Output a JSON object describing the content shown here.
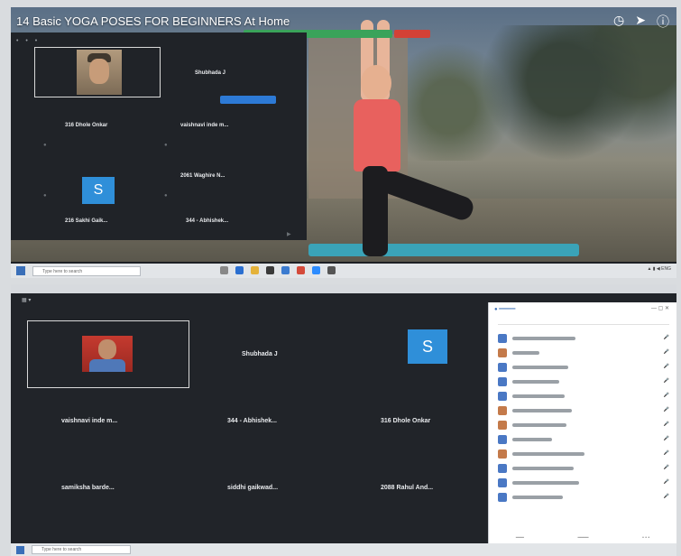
{
  "top": {
    "video_title": "14 Basic YOGA POSES FOR BEGINNERS At Home",
    "participants": [
      {
        "name": "Shubhada J"
      },
      {
        "name": "316 Dhole Onkar"
      },
      {
        "name": "vaishnavi inde m..."
      },
      {
        "name": "2061 Waghire N..."
      },
      {
        "name": "216 Sakhi Gaik..."
      },
      {
        "name": "344 - Abhishek..."
      }
    ],
    "tile_initial": "S",
    "taskbar_search": "Type here to search"
  },
  "bottom": {
    "participants": [
      {
        "name": "Shubhada J"
      },
      {
        "name": "vaishnavi inde m..."
      },
      {
        "name": "344 - Abhishek..."
      },
      {
        "name": "316 Dhole Onkar"
      },
      {
        "name": "samiksha barde..."
      },
      {
        "name": "siddhi gaikwad..."
      },
      {
        "name": "2088 Rahul And..."
      }
    ],
    "tile_initial": "S",
    "taskbar_search": "Type here to search"
  },
  "colors": {
    "accent_blue": "#2f8fd9",
    "share_green": "#3aa35a",
    "stop_red": "#d34136"
  }
}
